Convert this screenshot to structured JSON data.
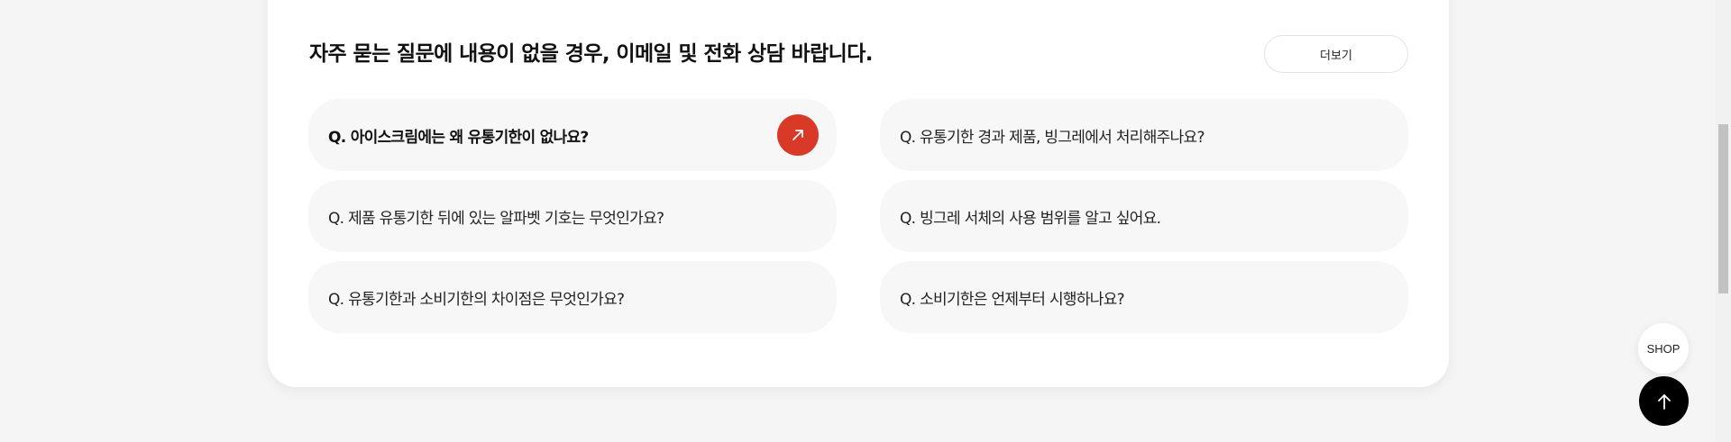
{
  "faq": {
    "heading": "자주 묻는 질문에 내용이 없을 경우, 이메일 및 전화 상담 바랍니다.",
    "more_label": "더보기",
    "items": [
      {
        "question": "Q. 아이스크림에는 왜 유통기한이 없나요?",
        "active": true
      },
      {
        "question": "Q. 유통기한 경과 제품, 빙그레에서 처리해주나요?",
        "active": false
      },
      {
        "question": "Q. 제품 유통기한 뒤에 있는 알파벳 기호는 무엇인가요?",
        "active": false
      },
      {
        "question": "Q. 빙그레 서체의 사용 범위를 알고 싶어요.",
        "active": false
      },
      {
        "question": "Q. 유통기한과 소비기한의 차이점은 무엇인가요?",
        "active": false
      },
      {
        "question": "Q. 소비기한은 언제부터 시행하나요?",
        "active": false
      }
    ],
    "active_icon": "arrow-up-right-icon",
    "accent_color": "#d93a28"
  },
  "floating": {
    "shop_label": "SHOP",
    "top_icon": "arrow-up-icon"
  }
}
